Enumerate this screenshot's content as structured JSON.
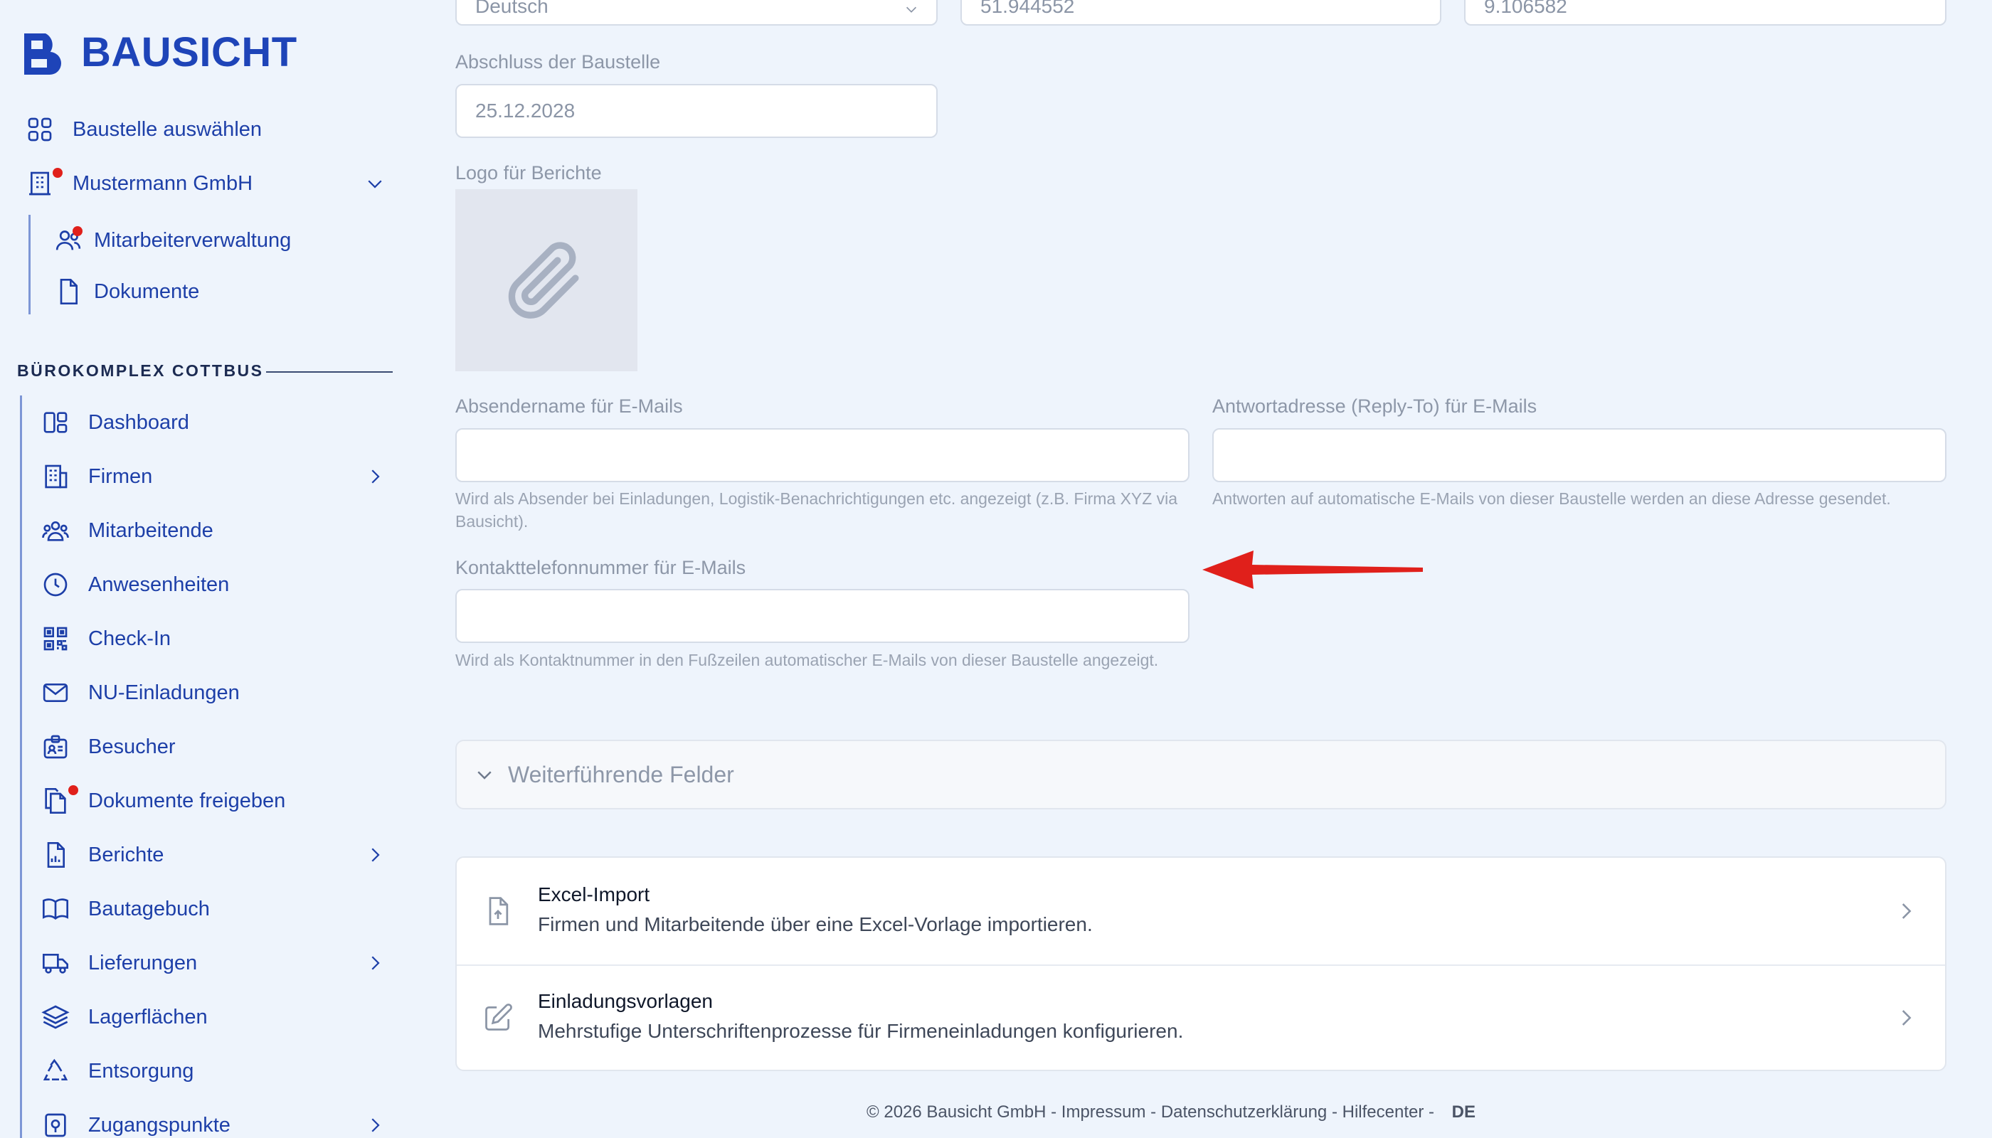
{
  "brand": {
    "name": "BAUSICHT",
    "accent": "#1e44b8"
  },
  "sidebar": {
    "top_items": [
      {
        "label": "Baustelle auswählen",
        "icon": "grid-icon"
      },
      {
        "label": "Mustermann GmbH",
        "icon": "office-building-icon",
        "badge": true,
        "expanded": true
      },
      {
        "label": "Mitarbeiterverwaltung",
        "icon": "users-icon",
        "badge": true
      },
      {
        "label": "Dokumente",
        "icon": "document-icon"
      }
    ],
    "section_title": "BÜROKOMPLEX COTTBUS",
    "items": [
      {
        "label": "Dashboard",
        "icon": "dashboard-icon"
      },
      {
        "label": "Firmen",
        "icon": "building-icon",
        "has_submenu": true
      },
      {
        "label": "Mitarbeitende",
        "icon": "team-icon"
      },
      {
        "label": "Anwesenheiten",
        "icon": "clock-icon"
      },
      {
        "label": "Check-In",
        "icon": "qr-code-icon"
      },
      {
        "label": "NU-Einladungen",
        "icon": "mail-icon"
      },
      {
        "label": "Besucher",
        "icon": "id-badge-icon"
      },
      {
        "label": "Dokumente freigeben",
        "icon": "documents-icon",
        "badge": true
      },
      {
        "label": "Berichte",
        "icon": "report-icon",
        "has_submenu": true
      },
      {
        "label": "Bautagebuch",
        "icon": "book-icon"
      },
      {
        "label": "Lieferungen",
        "icon": "truck-icon",
        "has_submenu": true
      },
      {
        "label": "Lagerflächen",
        "icon": "layers-icon"
      },
      {
        "label": "Entsorgung",
        "icon": "recycle-icon"
      },
      {
        "label": "Zugangspunkte",
        "icon": "access-point-icon",
        "has_submenu": true
      }
    ]
  },
  "form": {
    "top_row": {
      "language": "Deutsch",
      "latitude": "51.944552",
      "longitude": "9.106582"
    },
    "completion": {
      "label": "Abschluss der Baustelle",
      "value": "25.12.2028"
    },
    "report_logo": {
      "label": "Logo für Berichte",
      "icon": "paperclip-icon"
    },
    "sender_name": {
      "label": "Absendername für E-Mails",
      "value": "",
      "helper": "Wird als Absender bei Einladungen, Logistik-Benachrichtigungen etc. angezeigt (z.B. Firma XYZ via Bausicht)."
    },
    "reply_to": {
      "label": "Antwortadresse (Reply-To) für E-Mails",
      "value": "",
      "helper": "Antworten auf automatische E-Mails von dieser Baustelle werden an diese Adresse gesendet."
    },
    "contact_phone": {
      "label": "Kontakttelefonnummer für E-Mails",
      "value": "",
      "helper": "Wird als Kontaktnummer in den Fußzeilen automatischer E-Mails von dieser Baustelle angezeigt."
    },
    "advanced": {
      "label": "Weiterführende Felder",
      "expanded": false
    }
  },
  "actions": [
    {
      "title": "Excel-Import",
      "subtitle": "Firmen und Mitarbeitende über eine Excel-Vorlage importieren.",
      "icon": "file-upload-icon"
    },
    {
      "title": "Einladungsvorlagen",
      "subtitle": "Mehrstufige Unterschriftenprozesse für Firmeneinladungen konfigurieren.",
      "icon": "edit-icon"
    }
  ],
  "footer": {
    "copyright": "© 2026 Bausicht GmbH",
    "sep": " - ",
    "links": [
      "Impressum",
      "Datenschutzerklärung",
      "Hilfecenter"
    ],
    "trail": " - ",
    "lang": "DE"
  },
  "colors": {
    "annotation_arrow": "#e0201b",
    "badge": "#e0201b"
  }
}
